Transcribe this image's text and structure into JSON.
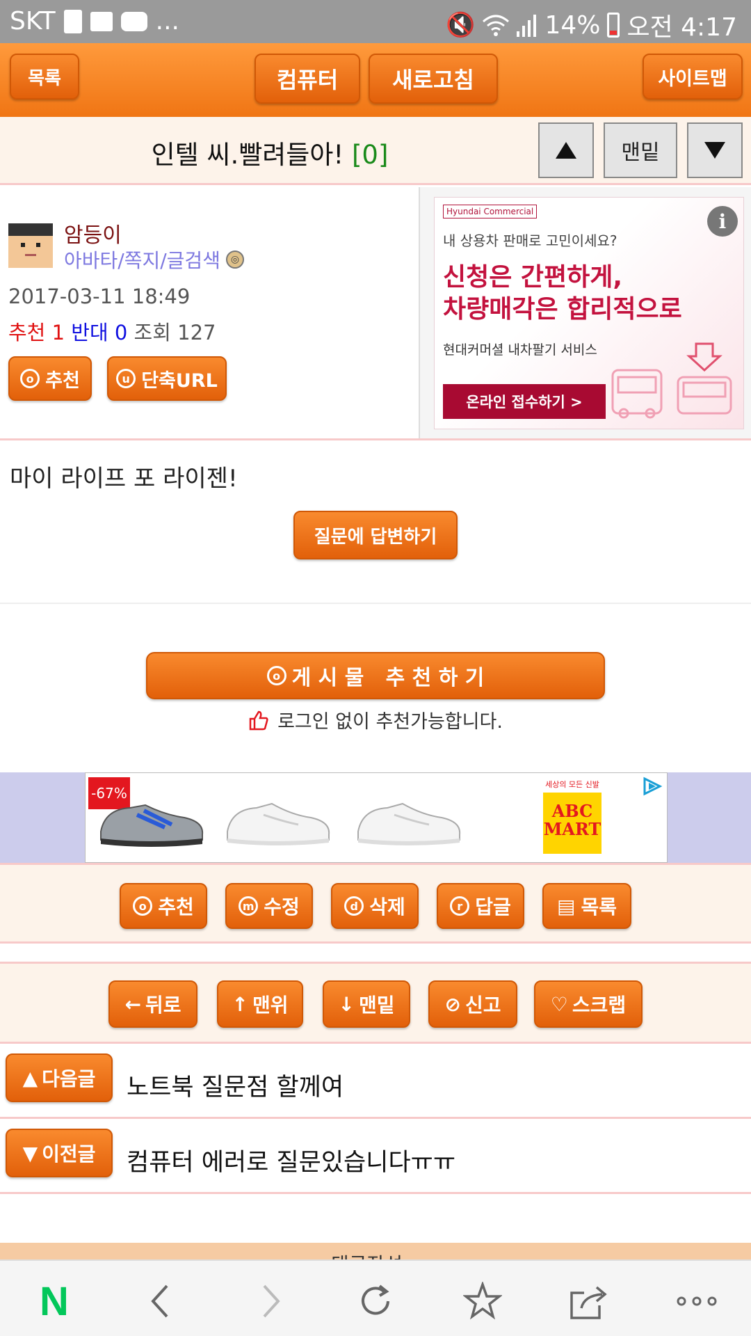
{
  "status_bar": {
    "carrier": "SKT",
    "more": "...",
    "battery_percent": "14%",
    "time": "오전 4:17"
  },
  "topbar": {
    "list_label": "목록",
    "computer_label": "컴퓨터",
    "refresh_label": "새로고침",
    "sitemap_label": "사이트맵"
  },
  "post": {
    "title": "인텔 씨.빨려들아!",
    "comment_count": "[0]",
    "bottom_label": "맨밑",
    "author": "암등이",
    "author_links": "아바타/쪽지/글검색",
    "date": "2017-03-11 18:49",
    "recommend_label": "추천",
    "recommend_count": "1",
    "oppose_label": "반대",
    "oppose_count": "0",
    "views_label": "조회",
    "views_count": "127",
    "recommend_button": "추천",
    "short_url_button": "단축URL",
    "body": "마이 라이프 포 라이젠!",
    "answer_button": "질문에 답변하기",
    "big_recommend_button": "게 시 물   추 천 하 기",
    "recommend_note": "로그인 없이 추천가능합니다."
  },
  "ad_hyundai": {
    "brand": "Hyundai Commercial",
    "subtitle": "내 상용차 판매로 고민이세요?",
    "headline_line1": "신청은 간편하게,",
    "headline_line2": "차량매각은 합리적으로",
    "service": "현대커머셜 내차팔기 서비스",
    "cta": "온라인 접수하기 >",
    "info": "i"
  },
  "ad_shoes": {
    "discount": "-67%",
    "store_tagline": "세상의 모든 신발",
    "store_line1": "ABC",
    "store_line2": "MART"
  },
  "actions": {
    "recommend": "추천",
    "edit": "수정",
    "delete": "삭제",
    "reply": "답글",
    "list": "목록"
  },
  "nav": {
    "back": "뒤로",
    "top": "맨위",
    "bottom": "맨밑",
    "report": "신고",
    "scrap": "스크랩"
  },
  "adjacent": {
    "next_label": "다음글",
    "next_title": "노트북 질문점 할께여",
    "prev_label": "이전글",
    "prev_title": "컴퓨터 에러로 질문있습니다ㅠㅠ"
  },
  "comment_header": "댓글작성",
  "colors": {
    "accent_orange": "#f07514",
    "button_orange": "#e2600a",
    "row_bg": "#fdf3ea",
    "divider_pink": "#f7c9c9",
    "naver_green": "#03c75a"
  },
  "icons": [
    "home-n-icon",
    "back-arrow-icon",
    "forward-arrow-icon",
    "refresh-icon",
    "bookmark-star-icon",
    "share-icon",
    "more-dots-icon"
  ]
}
